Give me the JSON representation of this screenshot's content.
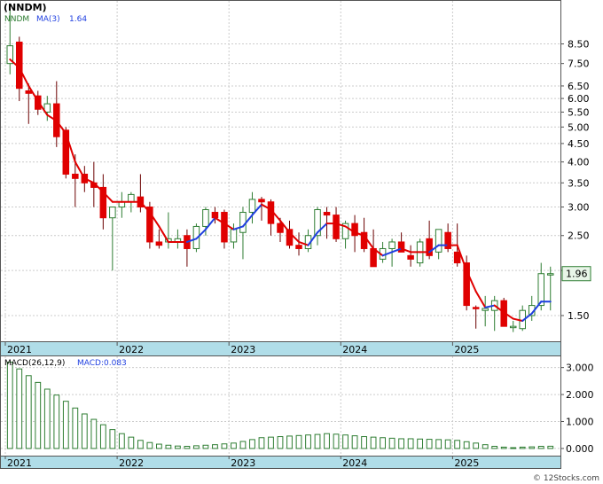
{
  "title": "(NNDM)",
  "watermark": "© 12Stocks.com",
  "colors": {
    "bull_body": "#ffffff",
    "bull_outline": "#2e7d32",
    "bear_body": "#e00000",
    "ma_up": "#1f3fe0",
    "ma_down": "#e00000",
    "macd_bar_fill": "#ffffff",
    "macd_bar_outline": "#2e7d32",
    "axis_band": "#b0dde8",
    "last_price_box": "#e8f5e8"
  },
  "chart_data": [
    {
      "type": "candlestick",
      "legend": {
        "ticker": "NNDM",
        "ma_label": "MA(3)",
        "ma_value": "1.64"
      },
      "last_price_label": "1.96",
      "y_scale": "log",
      "ylim": [
        1.28,
        11.0
      ],
      "y_ticks": [
        "8.50",
        "7.50",
        "6.50",
        "6.00",
        "5.50",
        "5.00",
        "4.50",
        "4.00",
        "3.50",
        "3.00",
        "2.50",
        "2.00",
        "1.50"
      ],
      "x_ticks": [
        "2021",
        "2022",
        "2023",
        "2024",
        "2025"
      ],
      "x_tick_index": [
        0,
        12,
        24,
        36,
        48
      ],
      "months": [
        "2021-01",
        "2021-02",
        "2021-03",
        "2021-04",
        "2021-05",
        "2021-06",
        "2021-07",
        "2021-08",
        "2021-09",
        "2021-10",
        "2021-11",
        "2021-12",
        "2022-01",
        "2022-02",
        "2022-03",
        "2022-04",
        "2022-05",
        "2022-06",
        "2022-07",
        "2022-08",
        "2022-09",
        "2022-10",
        "2022-11",
        "2022-12",
        "2023-01",
        "2023-02",
        "2023-03",
        "2023-04",
        "2023-05",
        "2023-06",
        "2023-07",
        "2023-08",
        "2023-09",
        "2023-10",
        "2023-11",
        "2023-12",
        "2024-01",
        "2024-02",
        "2024-03",
        "2024-04",
        "2024-05",
        "2024-06",
        "2024-07",
        "2024-08",
        "2024-09",
        "2024-10",
        "2024-11",
        "2024-12",
        "2025-01",
        "2025-02",
        "2025-03",
        "2025-04",
        "2025-05",
        "2025-06",
        "2025-07",
        "2025-08",
        "2025-09",
        "2025-10",
        "2025-11"
      ],
      "ohlc": [
        [
          7.5,
          11.0,
          7.0,
          8.4
        ],
        [
          8.6,
          8.9,
          5.9,
          6.4
        ],
        [
          6.3,
          6.6,
          5.1,
          6.2
        ],
        [
          6.1,
          6.3,
          5.4,
          5.6
        ],
        [
          5.5,
          6.1,
          5.2,
          5.8
        ],
        [
          5.8,
          6.7,
          4.4,
          4.7
        ],
        [
          4.9,
          5.0,
          3.6,
          3.7
        ],
        [
          3.7,
          4.2,
          3.0,
          3.6
        ],
        [
          3.7,
          3.9,
          3.3,
          3.5
        ],
        [
          3.5,
          4.0,
          3.0,
          3.4
        ],
        [
          3.4,
          3.7,
          2.6,
          2.8
        ],
        [
          2.8,
          3.0,
          2.0,
          3.0
        ],
        [
          3.0,
          3.3,
          2.8,
          3.1
        ],
        [
          3.1,
          3.3,
          2.9,
          3.25
        ],
        [
          3.2,
          3.7,
          2.9,
          3.0
        ],
        [
          3.0,
          3.1,
          2.3,
          2.4
        ],
        [
          2.4,
          2.6,
          2.3,
          2.35
        ],
        [
          2.4,
          2.9,
          2.3,
          2.45
        ],
        [
          2.4,
          2.6,
          2.3,
          2.45
        ],
        [
          2.5,
          2.6,
          2.05,
          2.3
        ],
        [
          2.3,
          2.7,
          2.25,
          2.65
        ],
        [
          2.65,
          3.0,
          2.5,
          2.95
        ],
        [
          2.9,
          3.0,
          2.7,
          2.8
        ],
        [
          2.9,
          2.95,
          2.3,
          2.4
        ],
        [
          2.4,
          2.7,
          2.3,
          2.6
        ],
        [
          2.55,
          3.0,
          2.15,
          2.9
        ],
        [
          2.9,
          3.3,
          2.7,
          3.15
        ],
        [
          3.15,
          3.2,
          2.75,
          3.1
        ],
        [
          3.1,
          3.15,
          2.5,
          2.7
        ],
        [
          2.7,
          2.8,
          2.4,
          2.55
        ],
        [
          2.6,
          2.75,
          2.3,
          2.35
        ],
        [
          2.35,
          2.55,
          2.2,
          2.3
        ],
        [
          2.3,
          2.6,
          2.25,
          2.5
        ],
        [
          2.5,
          3.0,
          2.35,
          2.95
        ],
        [
          2.9,
          3.0,
          2.45,
          2.85
        ],
        [
          2.85,
          3.0,
          2.4,
          2.45
        ],
        [
          2.45,
          2.75,
          2.3,
          2.7
        ],
        [
          2.7,
          2.85,
          2.25,
          2.5
        ],
        [
          2.55,
          2.8,
          2.25,
          2.3
        ],
        [
          2.3,
          2.6,
          2.05,
          2.05
        ],
        [
          2.15,
          2.4,
          2.1,
          2.3
        ],
        [
          2.3,
          2.45,
          2.05,
          2.4
        ],
        [
          2.4,
          2.55,
          2.25,
          2.25
        ],
        [
          2.2,
          2.35,
          2.05,
          2.15
        ],
        [
          2.1,
          2.45,
          2.05,
          2.4
        ],
        [
          2.45,
          2.75,
          2.15,
          2.2
        ],
        [
          2.25,
          2.6,
          2.15,
          2.6
        ],
        [
          2.55,
          2.7,
          2.25,
          2.3
        ],
        [
          2.25,
          2.7,
          2.05,
          2.1
        ],
        [
          2.1,
          2.2,
          1.55,
          1.6
        ],
        [
          1.58,
          1.6,
          1.38,
          1.57
        ],
        [
          1.55,
          1.7,
          1.4,
          1.57
        ],
        [
          1.55,
          1.7,
          1.36,
          1.65
        ],
        [
          1.65,
          1.68,
          1.45,
          1.4
        ],
        [
          1.4,
          1.45,
          1.35,
          1.4
        ],
        [
          1.38,
          1.6,
          1.36,
          1.55
        ],
        [
          1.5,
          1.7,
          1.45,
          1.6
        ],
        [
          1.6,
          2.1,
          1.55,
          1.96
        ],
        [
          1.96,
          2.05,
          1.55,
          1.96
        ]
      ],
      "ma3": [
        7.7,
        7.3,
        6.5,
        5.9,
        5.4,
        5.2,
        4.8,
        4.0,
        3.6,
        3.5,
        3.3,
        3.1,
        3.1,
        3.1,
        3.1,
        2.9,
        2.65,
        2.4,
        2.4,
        2.4,
        2.45,
        2.6,
        2.8,
        2.7,
        2.6,
        2.65,
        2.85,
        3.05,
        2.95,
        2.75,
        2.55,
        2.4,
        2.35,
        2.55,
        2.7,
        2.7,
        2.65,
        2.55,
        2.5,
        2.3,
        2.2,
        2.25,
        2.3,
        2.25,
        2.25,
        2.25,
        2.35,
        2.35,
        2.35,
        2.0,
        1.75,
        1.58,
        1.6,
        1.53,
        1.47,
        1.45,
        1.52,
        1.64,
        1.64
      ],
      "ma3_up": [
        false,
        false,
        false,
        false,
        false,
        false,
        false,
        false,
        false,
        false,
        false,
        false,
        false,
        false,
        false,
        false,
        false,
        false,
        false,
        false,
        true,
        true,
        true,
        false,
        false,
        true,
        true,
        true,
        false,
        false,
        false,
        false,
        false,
        true,
        true,
        false,
        false,
        false,
        false,
        false,
        false,
        true,
        true,
        false,
        false,
        false,
        true,
        true,
        false,
        false,
        false,
        false,
        true,
        false,
        false,
        false,
        true,
        true,
        true
      ]
    },
    {
      "type": "bar",
      "legend": {
        "name": "MACD(26,12,9)",
        "value_label": "MACD:0.083"
      },
      "ylim": [
        -0.2,
        3.35
      ],
      "y_ticks": [
        "3.000",
        "2.000",
        "1.000",
        "0.000"
      ],
      "x_ticks": [
        "2021",
        "2022",
        "2023",
        "2024",
        "2025"
      ],
      "values": [
        3.2,
        2.95,
        2.7,
        2.45,
        2.2,
        1.98,
        1.75,
        1.5,
        1.28,
        1.08,
        0.88,
        0.7,
        0.55,
        0.42,
        0.3,
        0.22,
        0.16,
        0.12,
        0.09,
        0.08,
        0.1,
        0.12,
        0.14,
        0.17,
        0.2,
        0.26,
        0.33,
        0.4,
        0.42,
        0.44,
        0.46,
        0.48,
        0.5,
        0.52,
        0.55,
        0.53,
        0.5,
        0.47,
        0.44,
        0.42,
        0.4,
        0.38,
        0.36,
        0.36,
        0.35,
        0.34,
        0.33,
        0.32,
        0.3,
        0.25,
        0.2,
        0.14,
        0.08,
        0.05,
        0.03,
        0.05,
        0.06,
        0.08,
        0.083
      ]
    }
  ]
}
